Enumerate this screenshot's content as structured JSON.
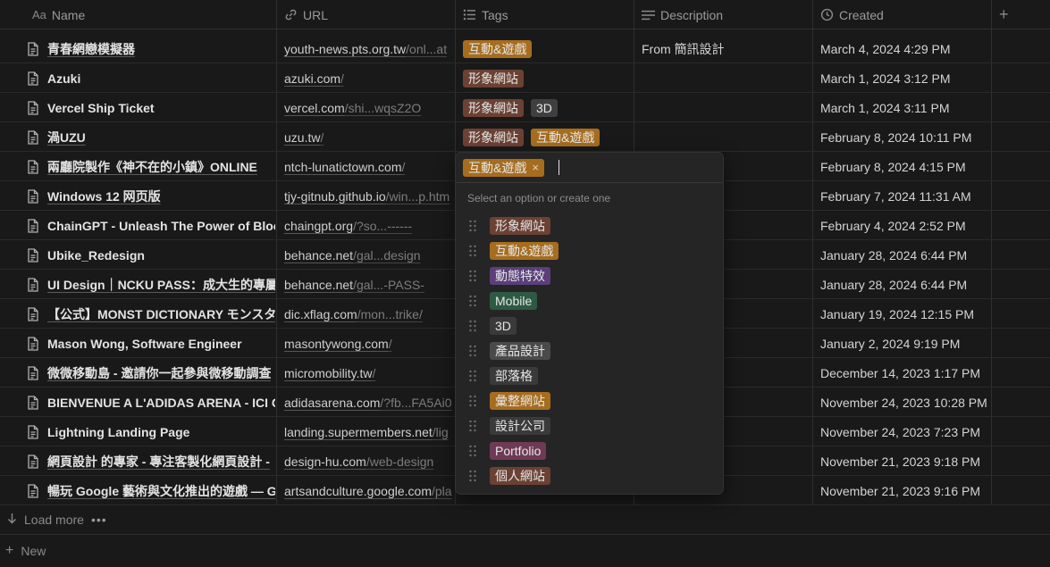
{
  "colors": {
    "background": "#191919",
    "tag_orange": "#a66d1f",
    "tag_brown": "#6b4133",
    "tag_gray": "#4a4a4a",
    "tag_purple": "#5a3f7a",
    "tag_green": "#2e5a43",
    "tag_pink": "#6e3a55",
    "tag_default": "#3a3a3a"
  },
  "header": {
    "columns": [
      {
        "icon": "Aa",
        "label": "Name"
      },
      {
        "icon": "link-icon",
        "label": "URL"
      },
      {
        "icon": "list-icon",
        "label": "Tags"
      },
      {
        "icon": "lines-icon",
        "label": "Description"
      },
      {
        "icon": "clock-icon",
        "label": "Created"
      }
    ],
    "add_column": "+"
  },
  "rows": [
    {
      "name": "青春網戀模擬器",
      "url_main": "youth-news.pts.org.tw",
      "url_rest": "/onl...at",
      "tags": [
        {
          "label": "互動&遊戲",
          "color": "#a66d1f"
        }
      ],
      "description": "From 簡訊設計",
      "created": "March 4, 2024 4:29 PM"
    },
    {
      "name": "Azuki",
      "url_main": "azuki.com",
      "url_rest": "/",
      "tags": [
        {
          "label": "形象網站",
          "color": "#6b4133"
        }
      ],
      "description": "",
      "created": "March 1, 2024 3:12 PM"
    },
    {
      "name": "Vercel Ship Ticket",
      "url_main": "vercel.com",
      "url_rest": "/shi...wqsZ2O",
      "tags": [
        {
          "label": "形象網站",
          "color": "#6b4133"
        },
        {
          "label": "3D",
          "color": "#3f3f3f"
        }
      ],
      "description": "",
      "created": "March 1, 2024 3:11 PM"
    },
    {
      "name": "渦UZU",
      "url_main": "uzu.tw",
      "url_rest": "/",
      "tags": [
        {
          "label": "形象網站",
          "color": "#6b4133"
        },
        {
          "label": "互動&遊戲",
          "color": "#a66d1f"
        }
      ],
      "description": "",
      "created": "February 8, 2024 10:11 PM"
    },
    {
      "name": "兩廳院製作《神不在的小鎮》ONLINE",
      "url_main": "ntch-lunatictown.com",
      "url_rest": "/",
      "tags": [],
      "description": "",
      "created": "February 8, 2024 4:15 PM"
    },
    {
      "name": "Windows 12 网页版",
      "url_main": "tjy-gitnub.github.io",
      "url_rest": "/win...p.htm",
      "tags": [],
      "description": "",
      "created": "February 7, 2024 11:31 AM"
    },
    {
      "name": "ChainGPT - Unleash The Power of Blockchain",
      "url_main": "chaingpt.org",
      "url_rest": "/?so...------",
      "tags": [],
      "description": "",
      "created": "February 4, 2024 2:52 PM"
    },
    {
      "name": "Ubike_Redesign",
      "url_main": "behance.net",
      "url_rest": "/gal...design",
      "tags": [],
      "description": "",
      "created": "January 28, 2024 6:44 PM"
    },
    {
      "name": "UI Design｜NCKU PASS：成大生的專屬",
      "url_main": "behance.net",
      "url_rest": "/gal...-PASS-",
      "tags": [],
      "description": "",
      "created": "January 28, 2024 6:44 PM"
    },
    {
      "name": "【公式】MONST DICTIONARY モンスタ",
      "url_main": "dic.xflag.com",
      "url_rest": "/mon...trike/",
      "tags": [],
      "description": "",
      "created": "January 19, 2024 12:15 PM"
    },
    {
      "name": "Mason Wong, Software Engineer",
      "url_main": "masontywong.com",
      "url_rest": "/",
      "tags": [],
      "description": "",
      "created": "January 2, 2024 9:19 PM"
    },
    {
      "name": "微微移動島 - 邀請你一起參與微移動調查",
      "url_main": "micromobility.tw",
      "url_rest": "/",
      "tags": [],
      "description": "",
      "created": "December 14, 2023 1:17 PM"
    },
    {
      "name": "BIENVENUE A L'ADIDAS ARENA - ICI C'EST",
      "url_main": "adidasarena.com",
      "url_rest": "/?fb...FA5Ai0",
      "tags": [],
      "description": "",
      "created": "November 24, 2023 10:28 PM"
    },
    {
      "name": "Lightning Landing Page",
      "url_main": "landing.supermembers.net",
      "url_rest": "/lig",
      "tags": [],
      "description": "",
      "created": "November 24, 2023 7:23 PM"
    },
    {
      "name": "網頁設計 的專家 - 專注客製化網頁設計 -",
      "url_main": "design-hu.com",
      "url_rest": "/web-design",
      "tags": [],
      "description": "",
      "created": "November 21, 2023 9:18 PM"
    },
    {
      "name": "暢玩 Google 藝術與文化推出的遊戲 — Google",
      "url_main": "artsandculture.google.com",
      "url_rest": "/pla",
      "tags": [],
      "description": "",
      "created": "November 21, 2023 9:16 PM"
    }
  ],
  "footer": {
    "load_more": "Load more",
    "more_dots": "•••",
    "new_label": "New"
  },
  "popup": {
    "selected_tag": {
      "label": "互動&遊戲",
      "color": "#a66d1f"
    },
    "remove_symbol": "×",
    "hint": "Select an option or create one",
    "options": [
      {
        "label": "形象網站",
        "color": "#6b4133"
      },
      {
        "label": "互動&遊戲",
        "color": "#a66d1f"
      },
      {
        "label": "動態特效",
        "color": "#5a3f7a"
      },
      {
        "label": "Mobile",
        "color": "#2e5a43"
      },
      {
        "label": "3D",
        "color": "#3a3a3a"
      },
      {
        "label": "產品設計",
        "color": "#4a4a4a"
      },
      {
        "label": "部落格",
        "color": "#3a3a3a"
      },
      {
        "label": "彙整網站",
        "color": "#a66d1f"
      },
      {
        "label": "設計公司",
        "color": "#3a3a3a"
      },
      {
        "label": "Portfolio",
        "color": "#6e3a55"
      },
      {
        "label": "個人網站",
        "color": "#6b4133"
      }
    ]
  }
}
